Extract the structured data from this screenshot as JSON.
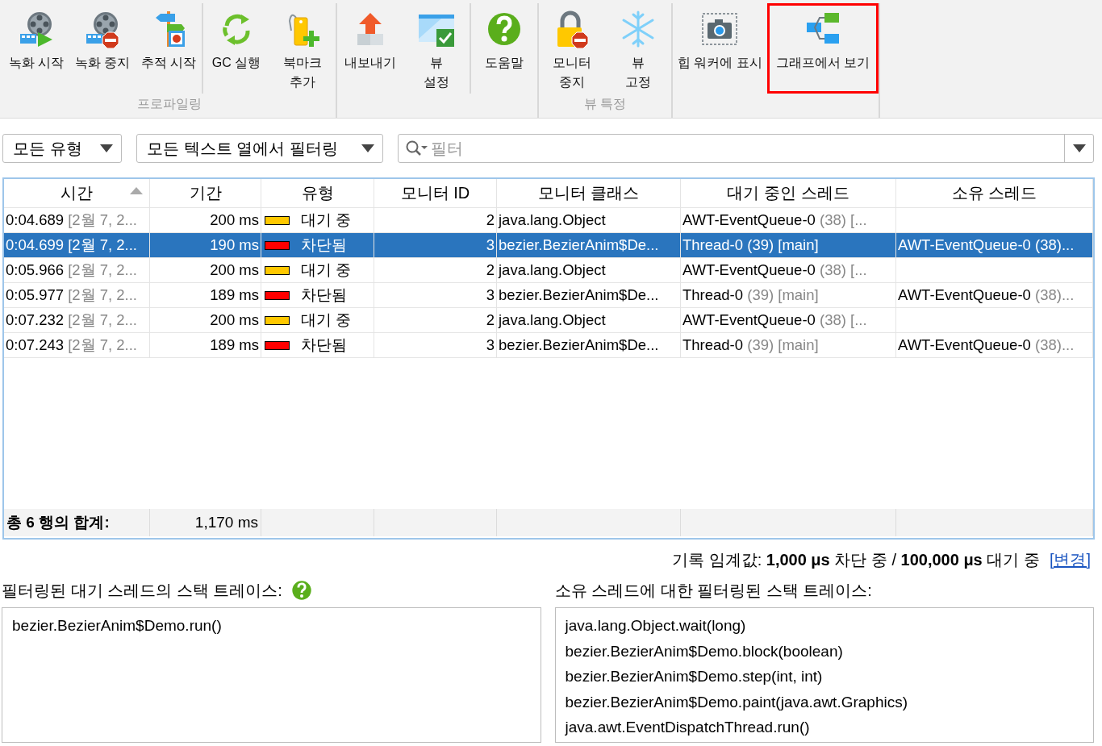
{
  "toolbar": {
    "groups": [
      {
        "label": "프로파일링",
        "sections": [
          [
            {
              "label": "녹화 시작",
              "kind": "record",
              "highlighted": false
            },
            {
              "label": "녹화 중지",
              "kind": "stop",
              "highlighted": false
            },
            {
              "label": "추적 시작",
              "kind": "trace",
              "highlighted": false
            }
          ],
          [
            {
              "label": "GC 실행",
              "kind": "gc",
              "highlighted": false
            },
            {
              "label": "북마크\n추가",
              "kind": "bookmark",
              "highlighted": false
            }
          ]
        ]
      },
      {
        "sections": [
          [
            {
              "label": "내보내기",
              "kind": "export",
              "highlighted": false
            },
            {
              "label": "뷰\n설정",
              "kind": "settings",
              "highlighted": false
            }
          ],
          [
            {
              "label": "도움말",
              "kind": "help",
              "highlighted": false
            }
          ]
        ]
      },
      {
        "label": "뷰 특정",
        "sections": [
          [
            {
              "label": "모니터\n중지",
              "kind": "monitor",
              "highlighted": false
            },
            {
              "label": "뷰\n고정",
              "kind": "freeze",
              "highlighted": false
            }
          ]
        ]
      },
      {
        "sections": [
          [
            {
              "label": "힙 워커에 표시",
              "kind": "heap",
              "highlighted": false
            },
            {
              "label": "그래프에서 보기",
              "kind": "graph",
              "highlighted": true
            }
          ]
        ]
      }
    ]
  },
  "filters": {
    "type_dropdown": "모든 유형",
    "column_dropdown": "모든 텍스트 열에서 필터링",
    "search": {
      "placeholder": "필터"
    }
  },
  "table": {
    "columns": [
      {
        "label": "시간",
        "sorted": true
      },
      {
        "label": "기간",
        "sorted": false
      },
      {
        "label": "유형",
        "sorted": false
      },
      {
        "label": "모니터 ID",
        "sorted": false
      },
      {
        "label": "모니터 클래스",
        "sorted": false
      },
      {
        "label": "대기 중인 스레드",
        "sorted": false
      },
      {
        "label": "소유 스레드",
        "sorted": false
      }
    ],
    "rows": [
      {
        "selected": false,
        "time": "0:04.689",
        "time_detail": "[2월 7, 2...",
        "duration": "200 ms",
        "type": {
          "label": "대기 중",
          "color": "#ffc800"
        },
        "monitor_id": "2",
        "monitor_class": "java.lang.Object",
        "waiting_thread": {
          "name": "AWT-EventQueue-0",
          "detail": "(38) [..."
        }
      },
      {
        "selected": true,
        "time": "0:04.699",
        "time_detail": "[2월 7, 2...",
        "duration": "190 ms",
        "type": {
          "label": "차단됨",
          "color": "#ff0000"
        },
        "monitor_id": "3",
        "monitor_class": "bezier.BezierAnim$De...",
        "waiting_thread": {
          "name": "Thread-0",
          "detail": "(39) [main]"
        },
        "owner_thread": {
          "name": "AWT-EventQueue-0",
          "detail": "(38)..."
        }
      },
      {
        "selected": false,
        "time": "0:05.966",
        "time_detail": "[2월 7, 2...",
        "duration": "200 ms",
        "type": {
          "label": "대기 중",
          "color": "#ffc800"
        },
        "monitor_id": "2",
        "monitor_class": "java.lang.Object",
        "waiting_thread": {
          "name": "AWT-EventQueue-0",
          "detail": "(38) [..."
        }
      },
      {
        "selected": false,
        "time": "0:05.977",
        "time_detail": "[2월 7, 2...",
        "duration": "189 ms",
        "type": {
          "label": "차단됨",
          "color": "#ff0000"
        },
        "monitor_id": "3",
        "monitor_class": "bezier.BezierAnim$De...",
        "waiting_thread": {
          "name": "Thread-0",
          "detail": "(39) [main]"
        },
        "owner_thread": {
          "name": "AWT-EventQueue-0",
          "detail": "(38)..."
        }
      },
      {
        "selected": false,
        "time": "0:07.232",
        "time_detail": "[2월 7, 2...",
        "duration": "200 ms",
        "type": {
          "label": "대기 중",
          "color": "#ffc800"
        },
        "monitor_id": "2",
        "monitor_class": "java.lang.Object",
        "waiting_thread": {
          "name": "AWT-EventQueue-0",
          "detail": "(38) [..."
        }
      },
      {
        "selected": false,
        "time": "0:07.243",
        "time_detail": "[2월 7, 2...",
        "duration": "189 ms",
        "type": {
          "label": "차단됨",
          "color": "#ff0000"
        },
        "monitor_id": "3",
        "monitor_class": "bezier.BezierAnim$De...",
        "waiting_thread": {
          "name": "Thread-0",
          "detail": "(39) [main]"
        },
        "owner_thread": {
          "name": "AWT-EventQueue-0",
          "detail": "(38)..."
        }
      }
    ],
    "totals": {
      "label": "총 6 행의 합계:",
      "duration": "1,170 ms"
    }
  },
  "threshold": {
    "text": "기록 임계값: **1,000 μs** 차단 중 / **100,000 μs** 대기 중",
    "link": "[변경]"
  },
  "stack_traces": [
    {
      "title": "필터링된 대기 스레드의 스택 트레이스:",
      "help": true,
      "lines": [
        "bezier.BezierAnim$Demo.run()"
      ]
    },
    {
      "title": "소유 스레드에 대한 필터링된 스택 트레이스:",
      "help": false,
      "lines": [
        "java.lang.Object.wait(long)",
        "bezier.BezierAnim$Demo.block(boolean)",
        "bezier.BezierAnim$Demo.step(int, int)",
        "bezier.BezierAnim$Demo.paint(java.awt.Graphics)",
        "java.awt.EventDispatchThread.run()"
      ]
    }
  ]
}
